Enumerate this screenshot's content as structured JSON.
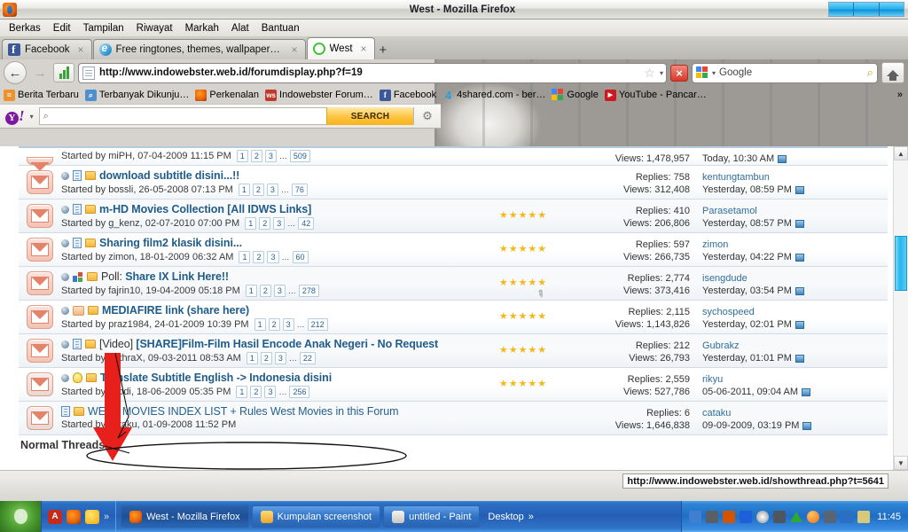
{
  "window": {
    "title": "West - Mozilla Firefox",
    "app_icon": "firefox-icon"
  },
  "menubar": {
    "items": [
      "Berkas",
      "Edit",
      "Tampilan",
      "Riwayat",
      "Markah",
      "Alat",
      "Bantuan"
    ]
  },
  "tabs": [
    {
      "label": "Facebook",
      "icon": "facebook-icon",
      "active": false,
      "close": "×"
    },
    {
      "label": "Free ringtones, themes, wallpapers…",
      "icon": "ie-icon",
      "active": false,
      "close": "×"
    },
    {
      "label": "West",
      "icon": "west-icon",
      "active": true,
      "close": "×"
    }
  ],
  "tab_new_label": "+",
  "navbar": {
    "back_glyph": "←",
    "forward_glyph": "→",
    "url": "http://www.indowebster.web.id/forumdisplay.php?f=19",
    "star_glyph": "☆",
    "dropdown_glyph": "▾",
    "stop_glyph": "×",
    "search_engine": "Google",
    "search_magnifier": "⌕",
    "home_title": "Home"
  },
  "bookmarks": {
    "items": [
      {
        "label": "Berita Terbaru",
        "icon": "rss-icon",
        "color": "#f0922b"
      },
      {
        "label": "Terbanyak Dikunju…",
        "icon": "magnifier-icon",
        "color": "#4f8fd0"
      },
      {
        "label": "Perkenalan",
        "icon": "firefox-icon",
        "color": "#e8620d"
      },
      {
        "label": "Indowebster Forum…",
        "icon": "ws-icon",
        "color": "#c0392b"
      },
      {
        "label": "Facebook",
        "icon": "facebook-icon",
        "color": "#3b5998"
      },
      {
        "label": "4shared.com - ber…",
        "icon": "four-icon",
        "color": "#2f9ed8"
      },
      {
        "label": "Google",
        "icon": "google-icon",
        "color": "#4285f4"
      },
      {
        "label": "YouTube - Pancar…",
        "icon": "youtube-icon",
        "color": "#cc181e"
      }
    ],
    "overflow_glyph": "»"
  },
  "yahoo_toolbar": {
    "logo": "Y!",
    "logo_o": "Y",
    "logo_bang": "!",
    "dropdown_glyph": "▾",
    "search_placeholder": "",
    "search_value": "",
    "magnifier": "⌕",
    "search_button": "SEARCH",
    "gear_glyph": "⚙"
  },
  "forum": {
    "partial_row": {
      "starter": "Started by miPH, 07-04-2009 11:15 PM",
      "pages": [
        "1",
        "2",
        "3",
        "…",
        "509"
      ],
      "views": "Views: 1,478,957",
      "last_when": "Today, 10:30 AM"
    },
    "threads": [
      {
        "icon": "unread-envelope-icon",
        "prefix": "",
        "title": "download subtitle disini...!!",
        "starter": "Started by bossli, 26-05-2008 07:13 PM",
        "pages": [
          "1",
          "2",
          "3",
          "…",
          "76"
        ],
        "stars": 0,
        "replies": "Replies: 758",
        "views": "Views: 312,408",
        "last_user": "kentungtambun",
        "last_when": "Yesterday, 08:59 PM",
        "badges": [
          "dot-icon",
          "doc-icon",
          "folder-icon"
        ],
        "attachment": false
      },
      {
        "icon": "unread-envelope-icon",
        "prefix": "",
        "title": "m-HD Movies Collection [All IDWS Links]",
        "starter": "Started by g_kenz, 02-07-2010 07:00 PM",
        "pages": [
          "1",
          "2",
          "3",
          "…",
          "42"
        ],
        "stars": 5,
        "replies": "Replies: 410",
        "views": "Views: 206,806",
        "last_user": "Parasetamol",
        "last_when": "Yesterday, 08:57 PM",
        "badges": [
          "dot-icon",
          "doc-icon",
          "folder-icon"
        ],
        "attachment": false
      },
      {
        "icon": "unread-envelope-icon",
        "prefix": "",
        "title": "Sharing film2 klasik disini...",
        "starter": "Started by zimon, 18-01-2009 06:32 AM",
        "pages": [
          "1",
          "2",
          "3",
          "…",
          "60"
        ],
        "stars": 5,
        "replies": "Replies: 597",
        "views": "Views: 266,735",
        "last_user": "zimon",
        "last_when": "Yesterday, 04:22 PM",
        "badges": [
          "dot-icon",
          "doc-icon",
          "folder-icon"
        ],
        "attachment": false
      },
      {
        "icon": "unread-envelope-icon",
        "prefix": "Poll:",
        "title": "Share IX Link Here!!",
        "starter": "Started by fajrin10, 19-04-2009 05:18 PM",
        "pages": [
          "1",
          "2",
          "3",
          "…",
          "278"
        ],
        "stars": 5,
        "replies": "Replies: 2,774",
        "views": "Views: 373,416",
        "last_user": "isengdude",
        "last_when": "Yesterday, 03:54 PM",
        "badges": [
          "dot-icon",
          "poll-icon",
          "folder-icon"
        ],
        "attachment": true
      },
      {
        "icon": "unread-envelope-icon",
        "prefix": "",
        "title": "MEDIAFIRE link (share here)",
        "starter": "Started by praz1984, 24-01-2009 10:39 PM",
        "pages": [
          "1",
          "2",
          "3",
          "…",
          "212"
        ],
        "stars": 5,
        "replies": "Replies: 2,115",
        "views": "Views: 1,143,826",
        "last_user": "sychospeed",
        "last_when": "Yesterday, 02:01 PM",
        "badges": [
          "dot-icon",
          "hand-icon",
          "folder-icon"
        ],
        "attachment": false
      },
      {
        "icon": "unread-envelope-icon",
        "prefix": "[Video]",
        "title": "[SHARE]Film-Film Hasil Encode Anak Negeri - No Request",
        "starter": "Started by anthraX, 09-03-2011 08:53 AM",
        "pages": [
          "1",
          "2",
          "3",
          "…",
          "22"
        ],
        "stars": 5,
        "replies": "Replies: 212",
        "views": "Views: 26,793",
        "last_user": "Gubrakz",
        "last_when": "Yesterday, 01:01 PM",
        "badges": [
          "dot-icon",
          "doc-icon",
          "folder-icon"
        ],
        "attachment": false
      },
      {
        "icon": "locked-envelope-icon",
        "prefix": "",
        "title": "Translate Subtitle English -> Indonesia disini",
        "starter": "Started by jojodi, 18-06-2009 05:35 PM",
        "pages": [
          "1",
          "2",
          "3",
          "…",
          "256"
        ],
        "stars": 5,
        "replies": "Replies: 2,559",
        "views": "Views: 527,786",
        "last_user": "rikyu",
        "last_when": "05-06-2011, 09:04 AM",
        "badges": [
          "dot-icon",
          "bulb-icon",
          "folder-icon"
        ],
        "attachment": false
      },
      {
        "icon": "locked-envelope-icon",
        "prefix": "",
        "title": "WEST MOVIES INDEX LIST + Rules West Movies in this Forum",
        "starter": "Started by cataku, 01-09-2008 11:52 PM",
        "pages": [],
        "stars": 0,
        "replies": "Replies: 6",
        "views": "Views: 1,646,838",
        "last_user": "cataku",
        "last_when": "09-09-2009, 03:19 PM",
        "badges": [
          "doc-icon",
          "folder-icon"
        ],
        "attachment": false,
        "highlighted": true
      }
    ],
    "section_label": "Normal Threads"
  },
  "status_bar": {
    "url": "http://www.indowebster.web.id/showthread.php?t=5641"
  },
  "annotation": {
    "arrow_color": "#e8201b",
    "ellipse_color": "#000000",
    "target": "WEST MOVIES INDEX LIST + Rules West Movies in this Forum"
  },
  "taskbar": {
    "start_label": "",
    "quicklaunch": [
      {
        "name": "adobe-reader-icon",
        "glyph": "A",
        "color": "#c42b1c"
      },
      {
        "name": "firefox-icon",
        "glyph": "",
        "color": "#e8620d"
      },
      {
        "name": "smiley-icon",
        "glyph": "",
        "color": "#f2c322"
      }
    ],
    "quicklaunch_more": "»",
    "tasks": [
      {
        "label": "West - Mozilla Firefox",
        "icon": "firefox-icon",
        "active": true
      },
      {
        "label": "Kumpulan screenshot",
        "icon": "folder-icon",
        "active": false
      },
      {
        "label": "untitled - Paint",
        "icon": "paint-icon",
        "active": false
      }
    ],
    "desktop_label": "Desktop",
    "desktop_chevron": "»",
    "tray_icons": [
      "network-icon",
      "security-icon",
      "antivirus-icon",
      "bluetooth-icon",
      "norton-icon",
      "volume-mute-icon",
      "triangle-icon",
      "orange-icon",
      "monitor-icon",
      "blue-app-icon",
      "pointer-icon"
    ],
    "clock": "11:45"
  }
}
